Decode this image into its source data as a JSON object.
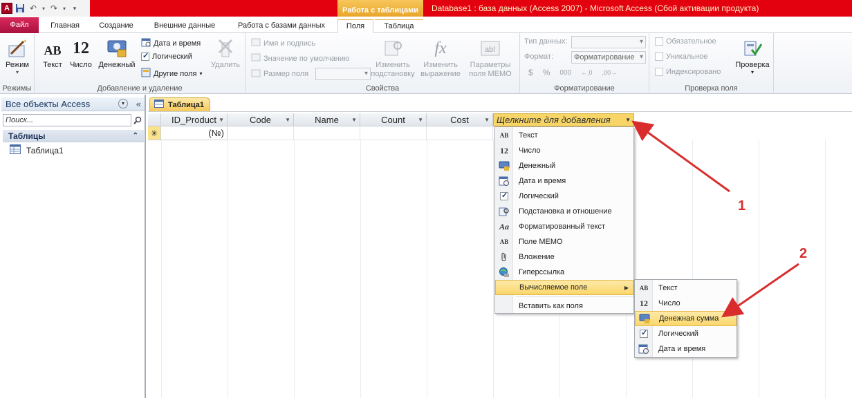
{
  "titlebar": {
    "window_title": "Database1 : база данных (Access 2007)  -  Microsoft Access (Сбой активации продукта)",
    "context_group": "Работа с таблицами",
    "app_icon": "A"
  },
  "tabs": [
    {
      "label": "Файл",
      "active": false
    },
    {
      "label": "Главная",
      "active": false
    },
    {
      "label": "Создание",
      "active": false
    },
    {
      "label": "Внешние данные",
      "active": false
    },
    {
      "label": "Работа с базами данных",
      "active": false
    },
    {
      "label": "Поля",
      "active": true
    },
    {
      "label": "Таблица",
      "active": false
    }
  ],
  "ribbon": {
    "views": {
      "label": "Режимы",
      "mode_button": "Режим"
    },
    "add_delete": {
      "label": "Добавление и удаление",
      "text": "Текст",
      "number": "Число",
      "currency": "Денежный",
      "datetime": "Дата и время",
      "logical": "Логический",
      "other_fields": "Другие поля",
      "delete": "Удалить"
    },
    "properties": {
      "label": "Свойства",
      "name_caption": "Имя и подпись",
      "default_value": "Значение по умолчанию",
      "field_size": "Размер поля",
      "change_lookup": "Изменить подстановку",
      "change_expression": "Изменить выражение",
      "memo_settings": "Параметры поля MEMO"
    },
    "formatting": {
      "label": "Форматирование",
      "data_type_label": "Тип данных:",
      "format_label": "Формат:",
      "format_value": "Форматирование"
    },
    "validation": {
      "label": "Проверка поля",
      "required": "Обязательное",
      "unique": "Уникальное",
      "indexed": "Индексировано",
      "check": "Проверка"
    }
  },
  "nav": {
    "header": "Все объекты Access",
    "search_placeholder": "Поиск...",
    "group": "Таблицы",
    "items": [
      "Таблица1"
    ]
  },
  "document": {
    "tab": "Таблица1",
    "columns": [
      "ID_Product",
      "Code",
      "Name",
      "Count",
      "Cost"
    ],
    "add_column": "Щелкните для добавления",
    "new_row_id": "(№)"
  },
  "menu_main": {
    "items": [
      {
        "icon": "AB",
        "icon_name": "text-icon",
        "label": "Текст"
      },
      {
        "icon": "12",
        "icon_name": "number-icon",
        "label": "Число"
      },
      {
        "icon": "$",
        "icon_name": "currency-icon",
        "label": "Денежный"
      },
      {
        "icon": "▦",
        "icon_name": "calendar-icon",
        "label": "Дата и время"
      },
      {
        "icon": "☑",
        "icon_name": "checkbox-icon",
        "label": "Логический"
      },
      {
        "icon": "⌘",
        "icon_name": "lookup-icon",
        "label": "Подстановка и отношение"
      },
      {
        "icon": "Aa",
        "icon_name": "rich-text-icon",
        "label": "Форматированный текст"
      },
      {
        "icon": "AB",
        "icon_name": "memo-icon",
        "label": "Поле MEMO"
      },
      {
        "icon": "⊘",
        "icon_name": "attachment-icon",
        "label": "Вложение"
      },
      {
        "icon": "◉",
        "icon_name": "hyperlink-icon",
        "label": "Гиперссылка"
      }
    ],
    "calc_field": "Вычисляемое поле",
    "paste_as_fields": "Вставить как поля"
  },
  "menu_sub": {
    "items": [
      {
        "icon": "AB",
        "icon_name": "text-icon",
        "label": "Текст"
      },
      {
        "icon": "12",
        "icon_name": "number-icon",
        "label": "Число"
      },
      {
        "icon": "$",
        "icon_name": "currency-icon",
        "label": "Денежная сумма"
      },
      {
        "icon": "☑",
        "icon_name": "checkbox-icon",
        "label": "Логический"
      },
      {
        "icon": "▦",
        "icon_name": "calendar-icon",
        "label": "Дата и время"
      }
    ]
  },
  "annotations": {
    "one": "1",
    "two": "2"
  },
  "colors": {
    "title_red": "#e3000f",
    "context_orange": "#f0b43c",
    "highlight": "#fbd76b",
    "arrow": "#d92d2d"
  }
}
